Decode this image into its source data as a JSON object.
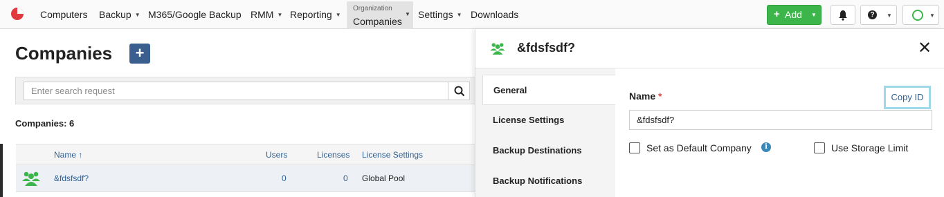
{
  "navbar": {
    "items": [
      {
        "label": "Computers",
        "caret": false
      },
      {
        "label": "Backup",
        "caret": true
      },
      {
        "label": "M365/Google Backup",
        "caret": false
      },
      {
        "label": "RMM",
        "caret": true
      },
      {
        "label": "Reporting",
        "caret": true
      },
      {
        "label": "Settings",
        "caret": true
      },
      {
        "label": "Downloads",
        "caret": false
      }
    ],
    "organization": {
      "small_label": "Organization",
      "label": "Companies"
    },
    "add_label": "Add",
    "brand_color": "#e03a3e",
    "add_color": "#3cb64a"
  },
  "companies": {
    "title": "Companies",
    "search_placeholder": "Enter search request",
    "count_text": "Companies: 6",
    "columns": [
      "Name ↑",
      "Users",
      "Licenses",
      "License Settings"
    ],
    "rows": [
      {
        "name": "&fdsfsdf?",
        "users": "0",
        "licenses": "0",
        "license_settings": "Global Pool"
      }
    ]
  },
  "detail": {
    "title": "&fdsfsdf?",
    "tabs": [
      "General",
      "License Settings",
      "Backup Destinations",
      "Backup Notifications"
    ],
    "active_tab": "General",
    "name_label": "Name",
    "required_mark": "*",
    "copy_id_label": "Copy ID",
    "name_value": "&fdsfsdf?",
    "default_company_label": "Set as Default Company",
    "storage_limit_label": "Use Storage Limit",
    "icon_color": "#3cb64a",
    "highlight_color": "#9fd8ea"
  }
}
